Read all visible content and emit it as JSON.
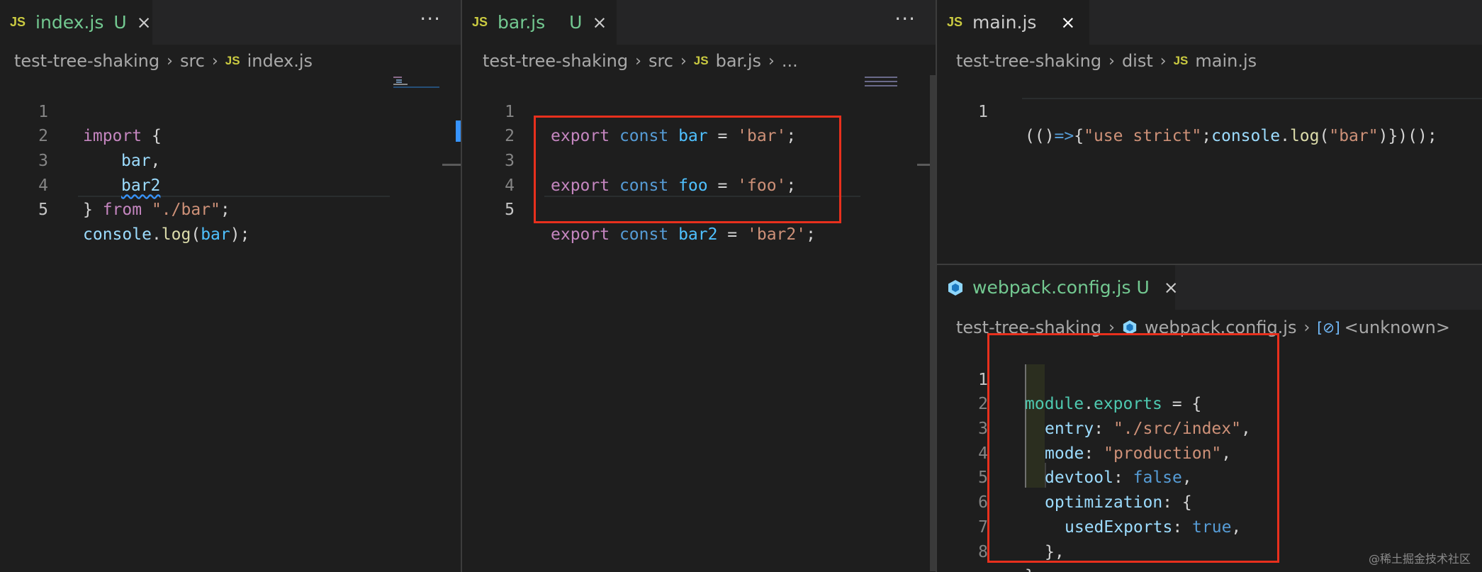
{
  "panes": {
    "index": {
      "tab": {
        "icon": "JS",
        "name": "index.js",
        "status": "U",
        "close": "×",
        "more": "···"
      },
      "breadcrumb": {
        "folder": "test-tree-shaking",
        "sub": "src",
        "icon": "JS",
        "file": "index.js",
        "sep": "›"
      },
      "lines": [
        "1",
        "2",
        "3",
        "4",
        "5"
      ],
      "code": {
        "l1": {
          "kw": "import",
          "p": " {"
        },
        "l2": {
          "v": "bar",
          "p": ","
        },
        "l3": {
          "v": "bar2"
        },
        "l4": {
          "p1": "} ",
          "kw": "from",
          "s": "\"./bar\"",
          "p2": ";"
        },
        "l5": {
          "obj": "console",
          "p1": ".",
          "fn": "log",
          "p2": "(",
          "v": "bar",
          "p3": ");"
        }
      }
    },
    "bar": {
      "tab": {
        "icon": "JS",
        "name": "bar.js",
        "status": "U",
        "close": "×",
        "more": "···"
      },
      "breadcrumb": {
        "folder": "test-tree-shaking",
        "sub": "src",
        "icon": "JS",
        "file": "bar.js",
        "more": "...",
        "sep": "›"
      },
      "lines": [
        "1",
        "2",
        "3",
        "4",
        "5"
      ],
      "code": {
        "l1": {
          "kw": "export",
          "st": "const",
          "v": "bar",
          "eq": " = ",
          "s": "'bar'",
          "p": ";"
        },
        "l3": {
          "kw": "export",
          "st": "const",
          "v": "foo",
          "eq": " = ",
          "s": "'foo'",
          "p": ";"
        },
        "l5": {
          "kw": "export",
          "st": "const",
          "v": "bar2",
          "eq": " = ",
          "s": "'bar2'",
          "p": ";"
        }
      }
    },
    "main": {
      "tab": {
        "icon": "JS",
        "name": "main.js",
        "close": "×"
      },
      "breadcrumb": {
        "folder": "test-tree-shaking",
        "sub": "dist",
        "icon": "JS",
        "file": "main.js",
        "sep": "›"
      },
      "lines": [
        "1"
      ],
      "code": {
        "p1": "(()",
        "arrow": "=>",
        "p2": "{",
        "s1": "\"use strict\"",
        "p3": ";",
        "obj": "console",
        "p4": ".",
        "fn": "log",
        "p5": "(",
        "s2": "\"bar\"",
        "p6": ")})();"
      }
    },
    "webpack": {
      "tab": {
        "name": "webpack.config.js",
        "status": "U",
        "close": "×"
      },
      "breadcrumb": {
        "folder": "test-tree-shaking",
        "file": "webpack.config.js",
        "symbol": "<unknown>",
        "sep": "›"
      },
      "lines": [
        "1",
        "2",
        "3",
        "4",
        "5",
        "6",
        "7",
        "8"
      ],
      "code": {
        "l1": {
          "obj": "module",
          "p1": ".",
          "prop": "exports",
          "p2": " = {"
        },
        "l2": {
          "key": "entry",
          "p1": ": ",
          "s": "\"./src/index\"",
          "p2": ","
        },
        "l3": {
          "key": "mode",
          "p1": ": ",
          "s": "\"production\"",
          "p2": ","
        },
        "l4": {
          "key": "devtool",
          "p1": ": ",
          "b": "false",
          "p2": ","
        },
        "l5": {
          "key": "optimization",
          "p1": ": {"
        },
        "l6": {
          "key": "usedExports",
          "p1": ": ",
          "b": "true",
          "p2": ","
        },
        "l7": {
          "p": "},"
        },
        "l8": {
          "p": "};"
        }
      }
    }
  },
  "watermark": "@稀土掘金技术社区",
  "colors": {
    "highlight": "#e8301d",
    "modified": "#73c991",
    "js_icon": "#cbcb41"
  }
}
